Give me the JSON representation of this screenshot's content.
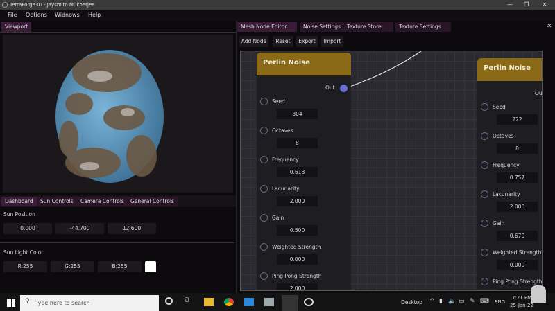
{
  "window": {
    "title": "TerraForge3D - Jaysmito Mukherjee"
  },
  "menu": [
    "File",
    "Options",
    "Widnows",
    "Help"
  ],
  "viewport_tab": "Viewport",
  "bottom_tabs": [
    "Dashboard",
    "Sun Controls",
    "Camera Controls",
    "General Controls"
  ],
  "sun": {
    "position_label": "Sun Position",
    "position": [
      "0.000",
      "-44.700",
      "12.600"
    ],
    "color_label": "Sun Light Color",
    "color": [
      "R:255",
      "G:255",
      "B:255"
    ],
    "swatch": "#ffffff"
  },
  "editor_tabs": [
    "Mesh Node Editor",
    "Noise Settings",
    "Texture Store",
    "Texture Settings"
  ],
  "close": "✕",
  "toolbar": [
    "Add Node",
    "Reset",
    "Export",
    "Import"
  ],
  "nodes": [
    {
      "title": "Perlin Noise",
      "out": "Out",
      "fields": [
        [
          "Seed",
          "804"
        ],
        [
          "Octaves",
          "8"
        ],
        [
          "Frequency",
          "0.618"
        ],
        [
          "Lacunarity",
          "2.000"
        ],
        [
          "Gain",
          "0.500"
        ],
        [
          "Weighted Strength",
          "0.000"
        ],
        [
          "Ping Pong Strength",
          "2.000"
        ]
      ]
    },
    {
      "title": "Perlin Noise",
      "out": "Out",
      "fields": [
        [
          "Seed",
          "222"
        ],
        [
          "Octaves",
          "8"
        ],
        [
          "Frequency",
          "0.757"
        ],
        [
          "Lacunarity",
          "2.000"
        ],
        [
          "Gain",
          "0.670"
        ],
        [
          "Weighted Strength",
          "0.000"
        ],
        [
          "Ping Pong Strength",
          ""
        ]
      ]
    }
  ],
  "colors": {
    "node_header": "#8a6a16",
    "pin_out": "#6b6bd6",
    "tab": "#2a1528"
  },
  "taskbar": {
    "search_placeholder": "Type here to search",
    "desktop": "Desktop",
    "lang": "ENG",
    "time": "7:21 PM",
    "date": "25-Jan-22"
  }
}
